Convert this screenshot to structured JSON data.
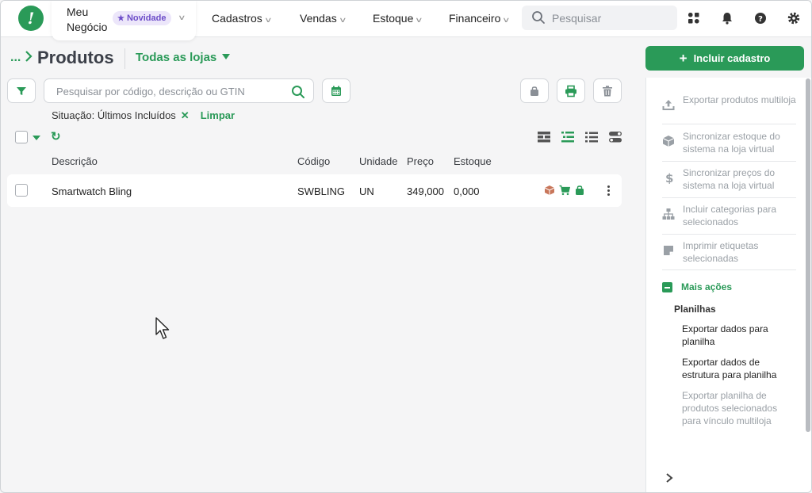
{
  "header": {
    "company_line1": "Meu",
    "company_line2": "Negócio",
    "badge": "Novidade",
    "nav": [
      "Cadastros",
      "Vendas",
      "Estoque",
      "Financeiro"
    ],
    "search_placeholder": "Pesquisar"
  },
  "page": {
    "breadcrumb": "...",
    "title": "Produtos",
    "store_select": "Todas as lojas",
    "search_placeholder": "Pesquisar por código, descrição ou GTIN",
    "filter_label": "Situação: Últimos Incluídos",
    "filter_remove": "✕",
    "filter_clear": "Limpar"
  },
  "table": {
    "columns": [
      "Descrição",
      "Código",
      "Unidade",
      "Preço",
      "Estoque"
    ],
    "rows": [
      {
        "descricao": "Smartwatch Bling",
        "codigo": "SWBLING",
        "unidade": "UN",
        "preco": "349,000",
        "estoque": "0,000"
      }
    ]
  },
  "panel": {
    "add_button": "Incluir cadastro",
    "actions": [
      {
        "label": "Exportar produtos multiloja",
        "icon": "upload-icon"
      },
      {
        "label": "Sincronizar estoque do sistema na loja virtual",
        "icon": "box-icon"
      },
      {
        "label": "Sincronizar preços do sistema na loja virtual",
        "icon": "dollar-icon"
      },
      {
        "label": "Incluir categorias para selecionados",
        "icon": "hierarchy-icon"
      },
      {
        "label": "Imprimir etiquetas selecionadas",
        "icon": "tag-icon"
      }
    ],
    "more_actions": "Mais ações",
    "sheets_header": "Planilhas",
    "sheets": [
      {
        "label": "Exportar dados para planilha",
        "disabled": false
      },
      {
        "label": "Exportar dados de estrutura para planilha",
        "disabled": false
      },
      {
        "label": "Exportar planilha de produtos selecionados para vínculo multiloja",
        "disabled": true
      }
    ]
  },
  "colors": {
    "brand": "#2a9a58",
    "badge_bg": "#ece6fa",
    "badge_text": "#6c4cc8"
  }
}
